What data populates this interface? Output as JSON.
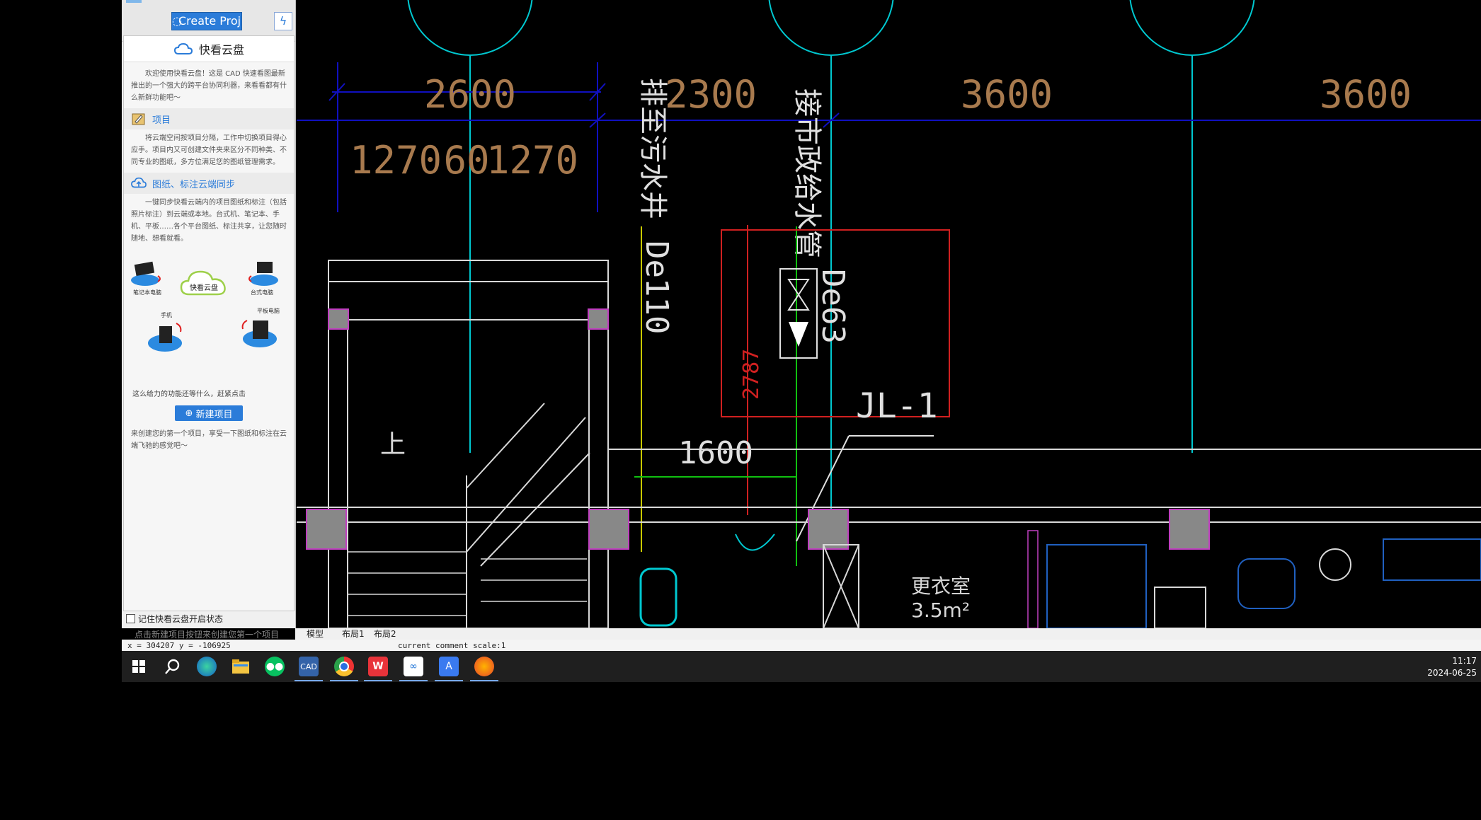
{
  "panel": {
    "create_project_label": "Create Projec",
    "title": "快看云盘",
    "intro": "欢迎使用快看云盘！这是 CAD 快速看图最新推出的一个强大的跨平台协同利器，来看看都有什么新鲜功能吧～",
    "section_project": {
      "heading": "项目",
      "text": "将云端空间按项目分隔，工作中切换项目得心应手。项目内又可创建文件夹来区分不同种类、不同专业的图纸，多方位满足您的图纸管理需求。"
    },
    "section_sync": {
      "heading": "图纸、标注云端同步",
      "text": "一键同步快看云端内的项目图纸和标注（包括照片标注）到云端或本地。台式机、笔记本、手机、平板……各个平台图纸、标注共享，让您随时随地、想看就看。"
    },
    "devices": {
      "laptop": "笔记本电脑",
      "cloud": "快看云盘",
      "desktop": "台式电脑",
      "phone": "手机",
      "tablet": "平板电脑"
    },
    "cta_text": "这么给力的功能还等什么，赶紧点击",
    "new_project_button": "新建项目",
    "footer_text": "来创建您的第一个项目，享受一下图纸和标注在云端飞驰的感觉吧～",
    "remember_label": "记住快看云盘开启状态",
    "hint": "点击新建项目按钮来创建您第一个项目"
  },
  "drawing": {
    "dims_top": [
      "2600",
      "2300",
      "3600",
      "3600"
    ],
    "dims_second": [
      "1270",
      "60",
      "1270"
    ],
    "label_drain": "排至污水井",
    "label_supply": "接市政给水管",
    "pipe_de110": "De110",
    "pipe_de63": "De63",
    "dim_2787": "2787",
    "dim_1600": "1600",
    "tag_jl1": "JL-1",
    "room_name": "更衣室",
    "room_area": "3.5m²",
    "stair_up": "上"
  },
  "layout_tabs": [
    "模型",
    "布局1",
    "布局2"
  ],
  "status": {
    "coords": "x = 304207  y = -106925",
    "comment_scale": "current comment scale:1"
  },
  "taskbar": {
    "time": "11:17",
    "date": "2024-06-25",
    "apps": [
      "start-icon",
      "search-icon",
      "edge-icon",
      "file-explorer-icon",
      "wechat-icon",
      "cad-viewer-icon",
      "chrome-icon",
      "wps-icon",
      "baidu-netdisk-icon",
      "feishu-icon",
      "firefox-icon"
    ]
  },
  "colors": {
    "cad_bg": "#000000",
    "axis_cyan": "#00c8d0",
    "dim_blue": "#1010c0",
    "dim_text": "#a87a4e",
    "red_box": "#d02020",
    "green_pipe": "#10c010",
    "yellow_pipe": "#c8c800",
    "magenta_col": "#c040c0",
    "accent": "#2b7cd9"
  }
}
